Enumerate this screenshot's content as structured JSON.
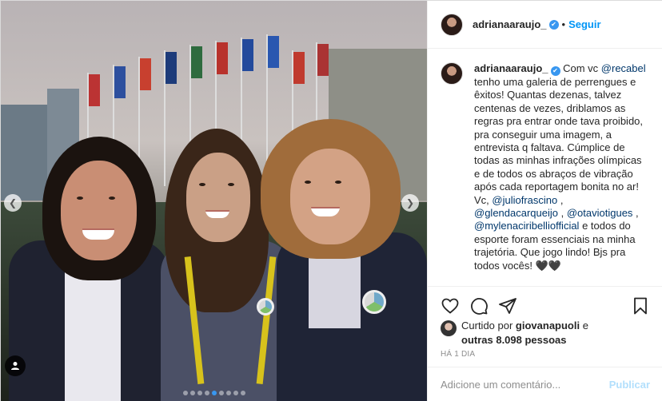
{
  "post": {
    "username": "adrianaaraujo_",
    "separator": "•",
    "follow_label": "Seguir",
    "verified_glyph": "✔"
  },
  "caption": {
    "username": "adrianaaraujo_",
    "part1": " Com vc ",
    "mention_recabel": "@recabel",
    "part2": " tenho uma galeria de perrengues e êxitos! Quantas dezenas, talvez centenas de vezes, driblamos as regras pra entrar onde tava proibido, pra conseguir uma imagem, a entrevista q faltava. Cúmplice de todas as minhas infrações olímpicas e de todos os abraços de vibração após cada reportagem bonita no ar! Vc, ",
    "mention_julio": "@juliofrascino",
    "comma1": " , ",
    "mention_glenda": "@glendacarqueijo",
    "comma2": " , ",
    "mention_otavio": "@otaviotigues",
    "comma3": " , ",
    "mention_mylena": "@mylenaciribelliofficial",
    "part3": " e todos do esporte foram essenciais na minha trajetória. Que jogo lindo! Bjs pra todos vocês! 🖤🖤"
  },
  "likes": {
    "prefix": "Curtido por ",
    "user": "giovanapuoli",
    "and": " e ",
    "others": "outras 8.098 pessoas"
  },
  "timestamp": "HÁ 1 DIA",
  "comment_box": {
    "placeholder": "Adicione um comentário...",
    "publish_label": "Publicar"
  },
  "carousel": {
    "count": 9,
    "active_index": 4
  },
  "icons": {
    "prev": "chevron-left-icon",
    "next": "chevron-right-icon",
    "tag": "user-tag-icon",
    "like": "heart-icon",
    "comment": "comment-icon",
    "share": "paper-plane-icon",
    "save": "bookmark-icon"
  },
  "colors": {
    "accent": "#0095f6",
    "mention": "#00376b",
    "muted": "#8e8e8e",
    "active_dot": "#3897f0"
  }
}
